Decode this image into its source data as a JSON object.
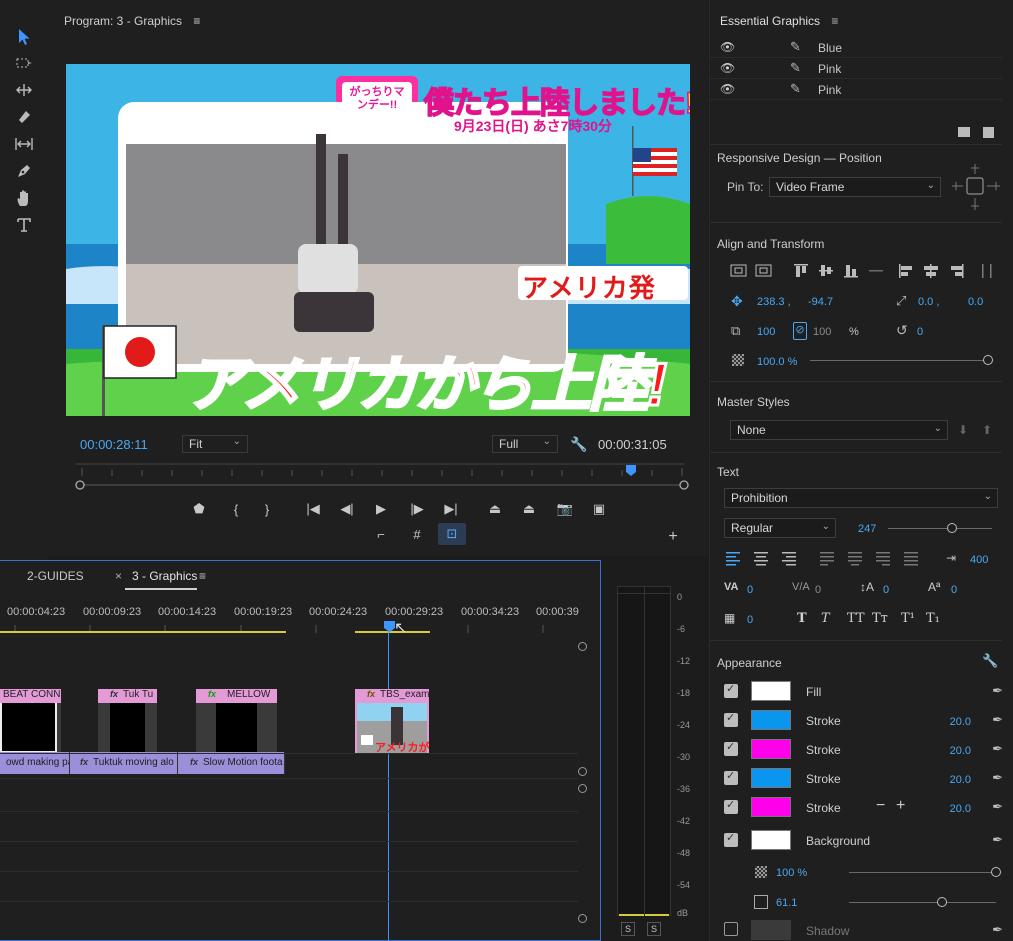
{
  "program": {
    "title": "Program: 3 - Graphics",
    "timecode_current": "00:00:28:11",
    "timecode_duration": "00:00:31:05",
    "zoom_value": "Fit",
    "quality_value": "Full"
  },
  "video": {
    "logo_text": "がっちりマンデー!!",
    "headline": "僕たち上陸しました!",
    "airtime": "9月23日(日) あさ7時30分",
    "origin_badge": "アメリカ発",
    "caption": "アメリカから上陸!"
  },
  "timeline": {
    "tabs": [
      "2-GUIDES",
      "3 - Graphics"
    ],
    "ruler": [
      "00:00:04:23",
      "00:00:09:23",
      "00:00:14:23",
      "00:00:19:23",
      "00:00:24:23",
      "00:00:29:23",
      "00:00:34:23",
      "00:00:39"
    ],
    "video_clips": [
      "BEAT CONNE",
      "Tuk Tu",
      "MELLOW",
      "TBS_exam"
    ],
    "audio_clips": [
      "owd making part",
      "Tuktuk moving alo",
      "Slow Motion foota"
    ],
    "tbs_caption": "アメリカが",
    "fx_label": "fx"
  },
  "meter": {
    "scale": [
      "0",
      "-6",
      "-12",
      "-18",
      "-24",
      "-30",
      "-36",
      "-42",
      "-48",
      "-54",
      "dB"
    ],
    "solo": [
      "S",
      "S"
    ]
  },
  "essential_graphics": {
    "title": "Essential Graphics",
    "layers": [
      "Blue",
      "Pink",
      "Pink"
    ],
    "responsive_title": "Responsive Design — Position",
    "pin_to_label": "Pin To:",
    "pin_to_value": "Video Frame",
    "align_title": "Align and Transform",
    "pos_x": "238.3 ,",
    "pos_y": "-94.7",
    "anchor_x": "0.0 ,",
    "anchor_y": "0.0",
    "scale": "100",
    "scale_locked": "100",
    "percent": "%",
    "rotation": "0",
    "opacity": "100.0 %",
    "opacity_level": 1.0,
    "master_title": "Master Styles",
    "master_value": "None",
    "text_title": "Text",
    "font": "Prohibition",
    "font_style": "Regular",
    "font_size": "247",
    "font_size_level": 0.62,
    "tab_width": "400",
    "kerning": "0",
    "tracking": "0",
    "leading": "0",
    "baseline": "0",
    "tsume": "0",
    "tt_buttons": [
      "T",
      "T",
      "TT",
      "Tт",
      "T¹",
      "T₁"
    ],
    "appearance_title": "Appearance",
    "appearance": [
      {
        "label": "Fill",
        "color": "#ffffff",
        "value": ""
      },
      {
        "label": "Stroke",
        "color": "#0a96ee",
        "value": "20.0"
      },
      {
        "label": "Stroke",
        "color": "#ff00ea",
        "value": "20.0"
      },
      {
        "label": "Stroke",
        "color": "#0a96ee",
        "value": "20.0"
      },
      {
        "label": "Stroke",
        "color": "#ff00ea",
        "value": "20.0"
      },
      {
        "label": "Background",
        "color": "#ffffff",
        "value": ""
      }
    ],
    "bg_opacity": "100 %",
    "bg_opacity_level": 1.0,
    "bg_size": "61.1",
    "bg_size_level": 0.63,
    "shadow_label": "Shadow",
    "minus": "−",
    "plus": "+"
  }
}
